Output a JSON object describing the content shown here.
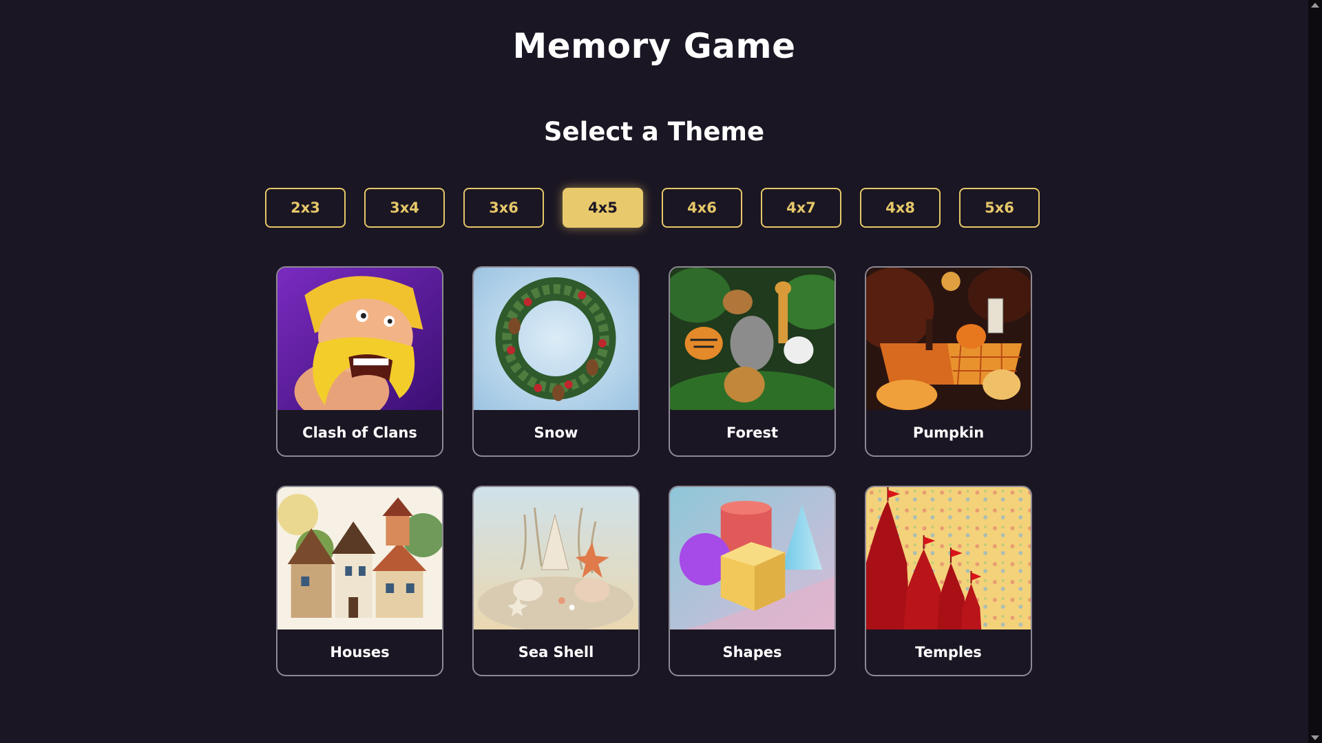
{
  "header": {
    "title": "Memory Game"
  },
  "theme_select": {
    "heading": "Select a Theme",
    "sizes": [
      {
        "label": "2x3",
        "active": false
      },
      {
        "label": "3x4",
        "active": false
      },
      {
        "label": "3x6",
        "active": false
      },
      {
        "label": "4x5",
        "active": true
      },
      {
        "label": "4x6",
        "active": false
      },
      {
        "label": "4x7",
        "active": false
      },
      {
        "label": "4x8",
        "active": false
      },
      {
        "label": "5x6",
        "active": false
      }
    ],
    "selected_size": "4x5"
  },
  "themes": [
    {
      "label": "Clash of Clans",
      "icon": "barbarian-image"
    },
    {
      "label": "Snow",
      "icon": "wreath-image"
    },
    {
      "label": "Forest",
      "icon": "animals-image"
    },
    {
      "label": "Pumpkin",
      "icon": "pumpkin-table-image"
    },
    {
      "label": "Houses",
      "icon": "houses-image"
    },
    {
      "label": "Sea Shell",
      "icon": "seashell-image"
    },
    {
      "label": "Shapes",
      "icon": "shapes-image"
    },
    {
      "label": "Temples",
      "icon": "temples-image"
    }
  ],
  "colors": {
    "background": "#1b1623",
    "accent": "#e8c96c",
    "card_border": "#8e8a95"
  }
}
